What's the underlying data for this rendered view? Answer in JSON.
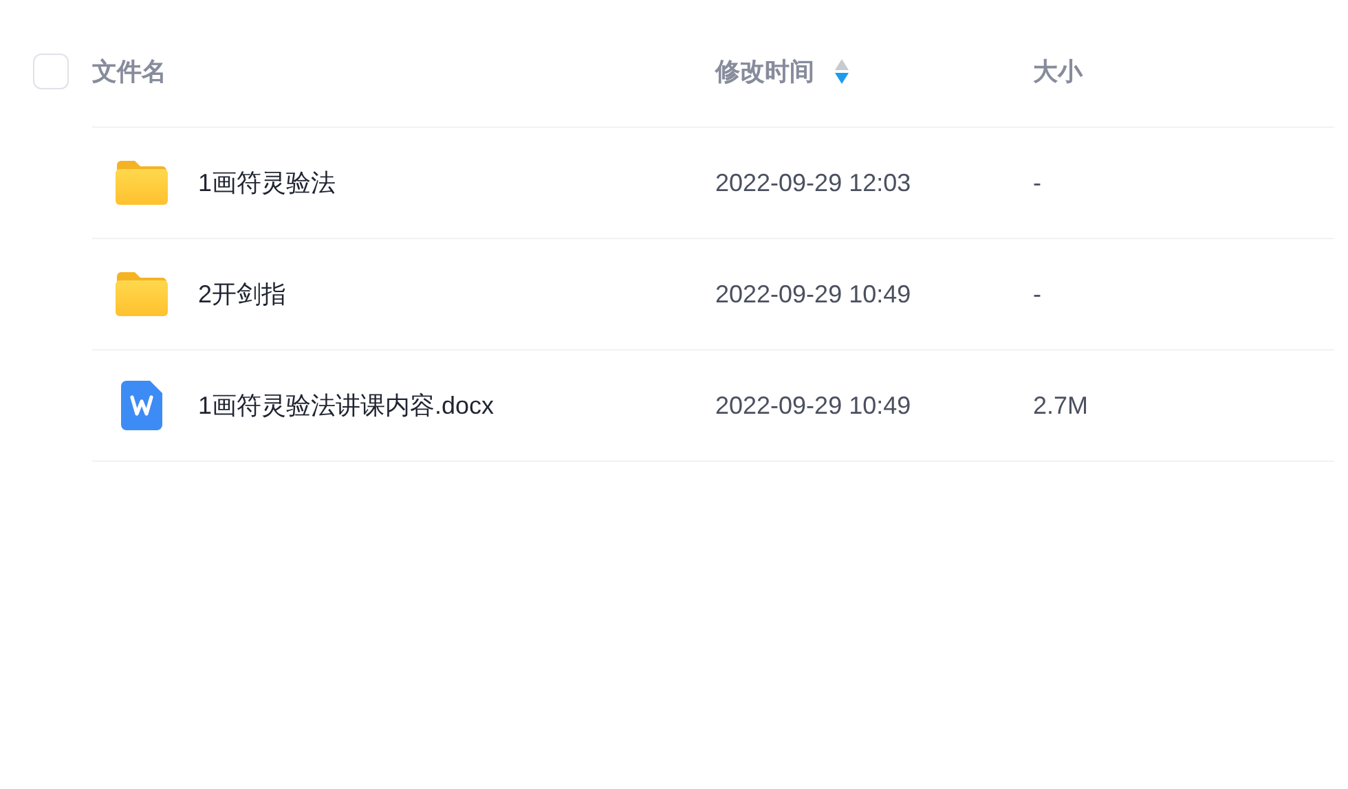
{
  "header": {
    "select_all": {
      "checked": false
    },
    "columns": [
      {
        "label": "文件名"
      },
      {
        "label": "修改时间",
        "sorted_descending": true
      },
      {
        "label": "大小"
      }
    ]
  },
  "rows": [
    {
      "kind": "folder",
      "name": "1画符灵验法",
      "modified": "2022-09-29 12:03",
      "size": "-"
    },
    {
      "kind": "folder",
      "name": "2开剑指",
      "modified": "2022-09-29 10:49",
      "size": "-"
    },
    {
      "kind": "document",
      "name": "1画符灵验法讲课内容.docx",
      "modified": "2022-09-29 10:49",
      "size": "2.7M"
    }
  ]
}
